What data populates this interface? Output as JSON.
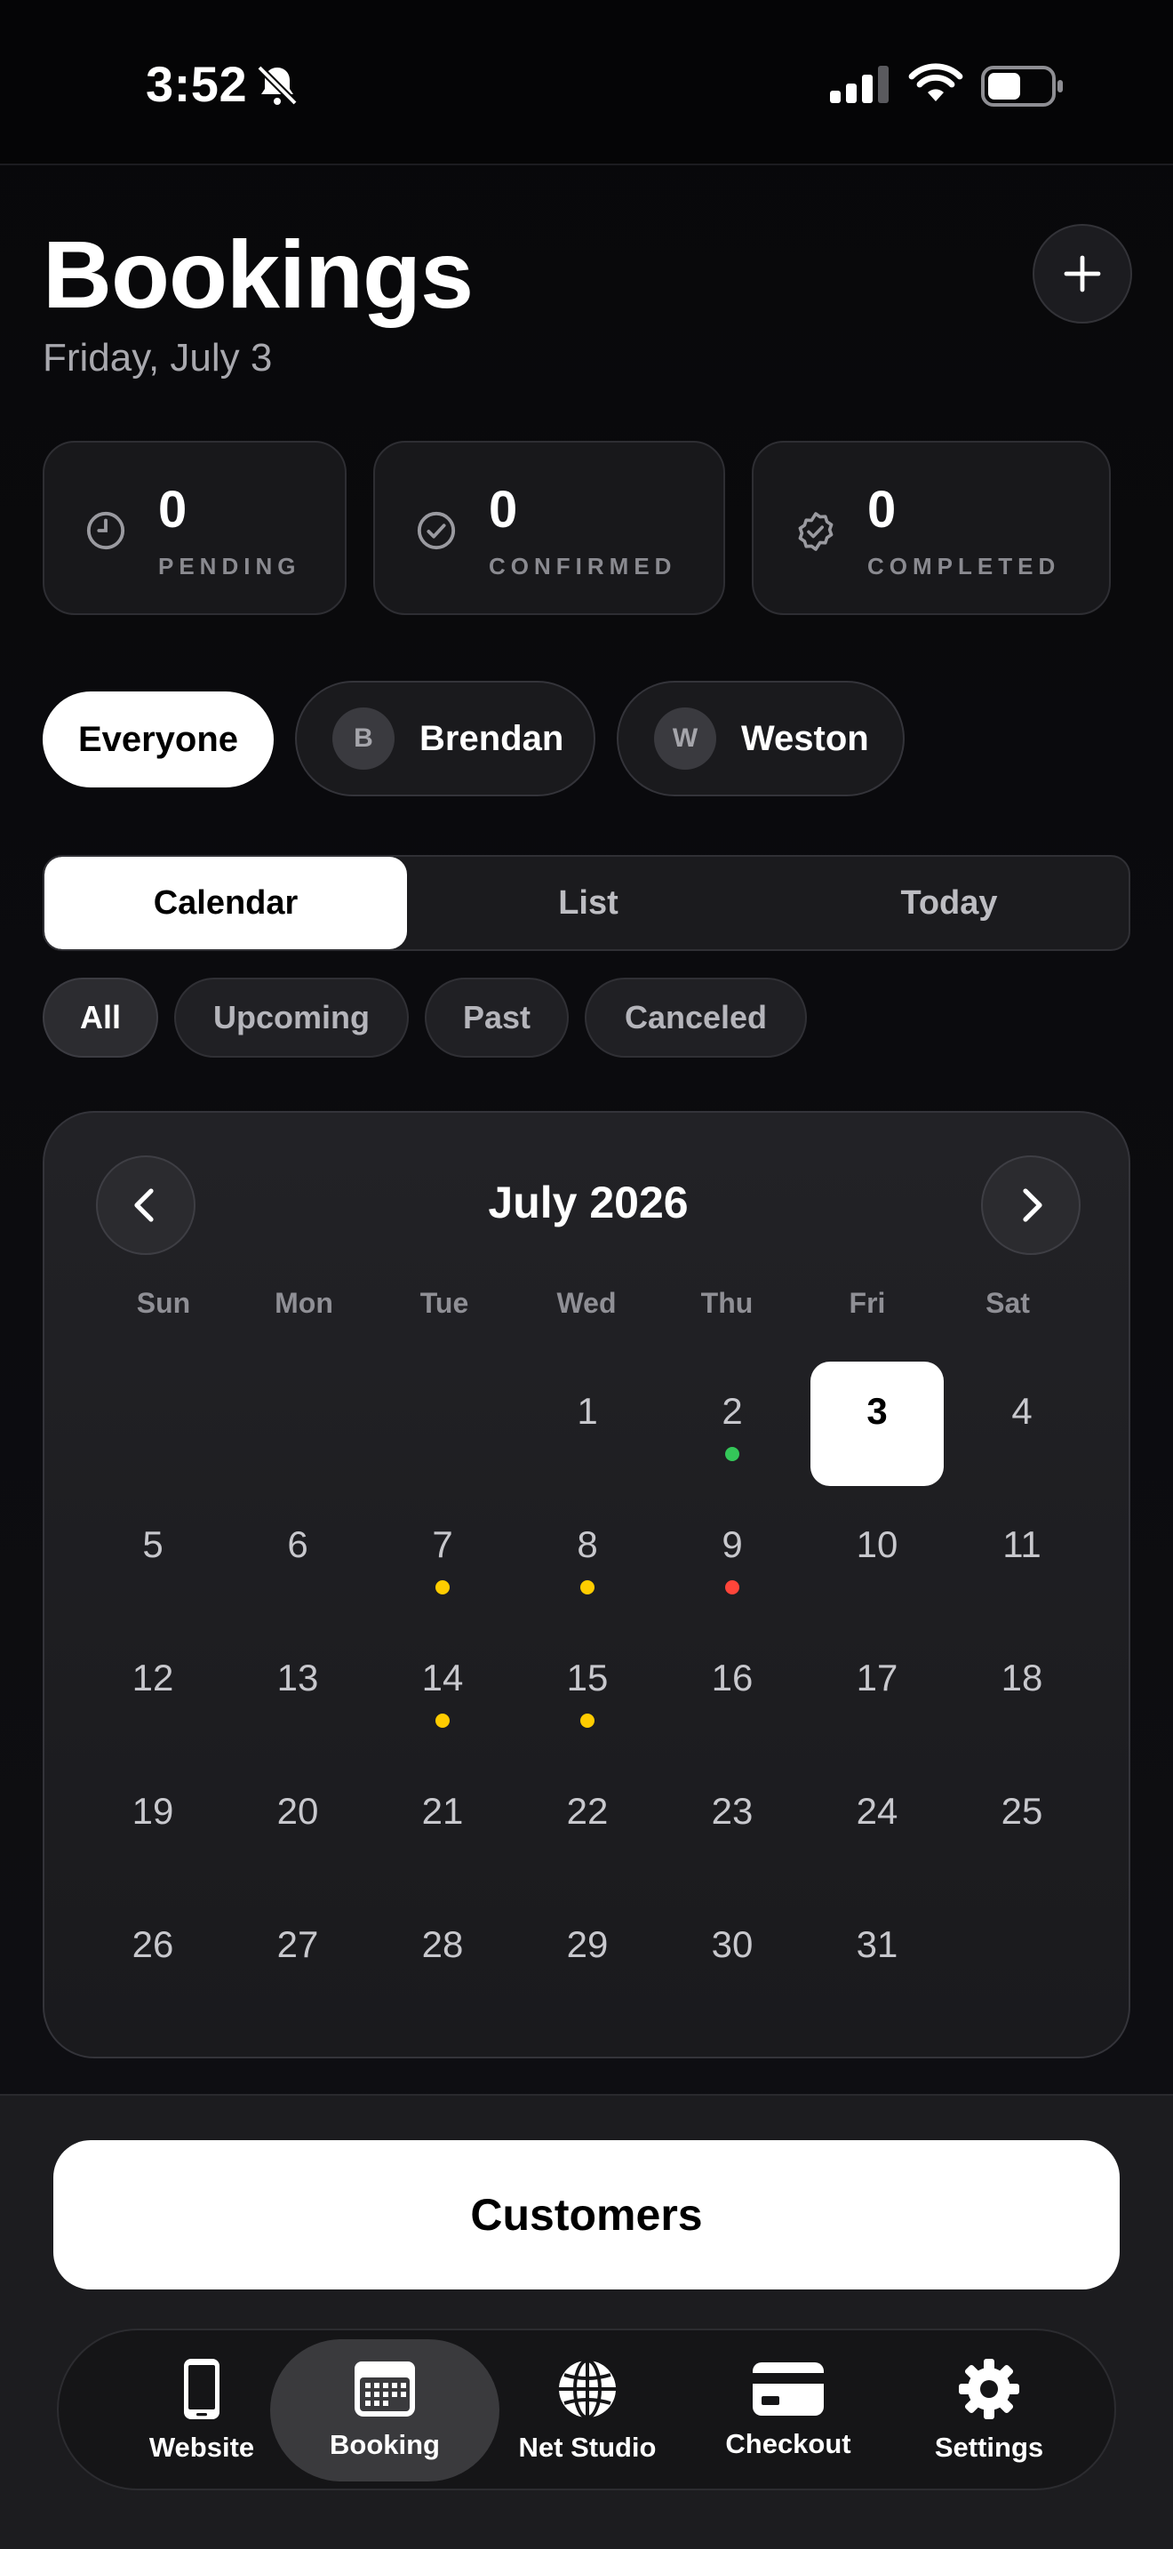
{
  "status_bar": {
    "time": "3:52",
    "icons": [
      "bell-slash-icon",
      "signal-icon",
      "wifi-icon",
      "battery-icon"
    ]
  },
  "header": {
    "title": "Bookings",
    "date": "Friday, July 3",
    "add_icon": "plus-icon"
  },
  "stats": [
    {
      "value": "0",
      "label": "PENDING",
      "icon": "clock-icon"
    },
    {
      "value": "0",
      "label": "CONFIRMED",
      "icon": "check-circle-icon"
    },
    {
      "value": "0",
      "label": "COMPLETED",
      "icon": "verified-badge-icon"
    }
  ],
  "people_filter": [
    {
      "label": "Everyone",
      "active": true
    },
    {
      "label": "Brendan",
      "initial": "B"
    },
    {
      "label": "Weston",
      "initial": "W"
    }
  ],
  "view_tabs": [
    {
      "label": "Calendar",
      "active": true
    },
    {
      "label": "List"
    },
    {
      "label": "Today"
    }
  ],
  "status_filters": [
    {
      "label": "All",
      "active": true
    },
    {
      "label": "Upcoming"
    },
    {
      "label": "Past"
    },
    {
      "label": "Canceled"
    }
  ],
  "calendar": {
    "month_title": "July 2026",
    "weekdays": [
      "Sun",
      "Mon",
      "Tue",
      "Wed",
      "Thu",
      "Fri",
      "Sat"
    ],
    "first_weekday_index": 3,
    "days_in_month": 31,
    "selected_day": 3,
    "event_dots": {
      "2": "green",
      "7": "yellow",
      "8": "yellow",
      "9": "red",
      "14": "yellow",
      "15": "yellow"
    }
  },
  "colors": {
    "green": "#34c759",
    "yellow": "#ffcc00",
    "red": "#ff453a",
    "accent": "#ffffff"
  },
  "customers_button": "Customers",
  "tab_bar": [
    {
      "label": "Website",
      "icon": "phone-icon"
    },
    {
      "label": "Booking",
      "icon": "calendar-icon",
      "active": true
    },
    {
      "label": "Net Studio",
      "icon": "globe-icon"
    },
    {
      "label": "Checkout",
      "icon": "credit-card-icon"
    },
    {
      "label": "Settings",
      "icon": "gear-icon"
    }
  ]
}
